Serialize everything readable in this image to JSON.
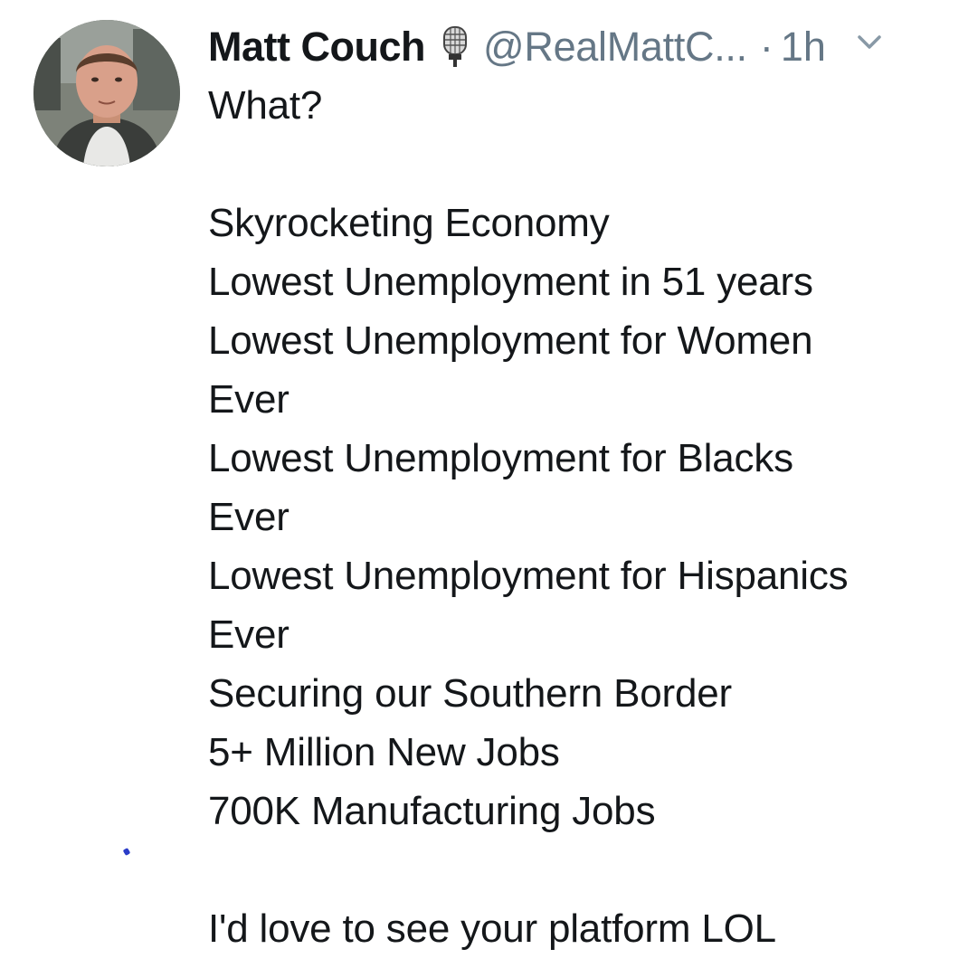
{
  "tweet": {
    "author": {
      "display_name": "Matt Couch",
      "name_emoji_icon": "microphone-icon",
      "handle": "@RealMattC...",
      "avatar": "user-avatar-photo"
    },
    "separator": "·",
    "time": "1h",
    "menu_icon": "chevron-down-icon",
    "text_lines": [
      "What?",
      "",
      "Skyrocketing Economy",
      "Lowest Unemployment in 51 years",
      "Lowest Unemployment for Women",
      "Ever",
      "Lowest Unemployment for Blacks",
      "Ever",
      "Lowest Unemployment for Hispanics",
      "Ever",
      "Securing our Southern Border",
      "5+ Million New Jobs",
      "700K Manufacturing Jobs",
      "",
      "I'd love to see your platform LOL"
    ]
  },
  "colors": {
    "text_primary": "#14171a",
    "text_secondary": "#657786",
    "background": "#ffffff"
  }
}
